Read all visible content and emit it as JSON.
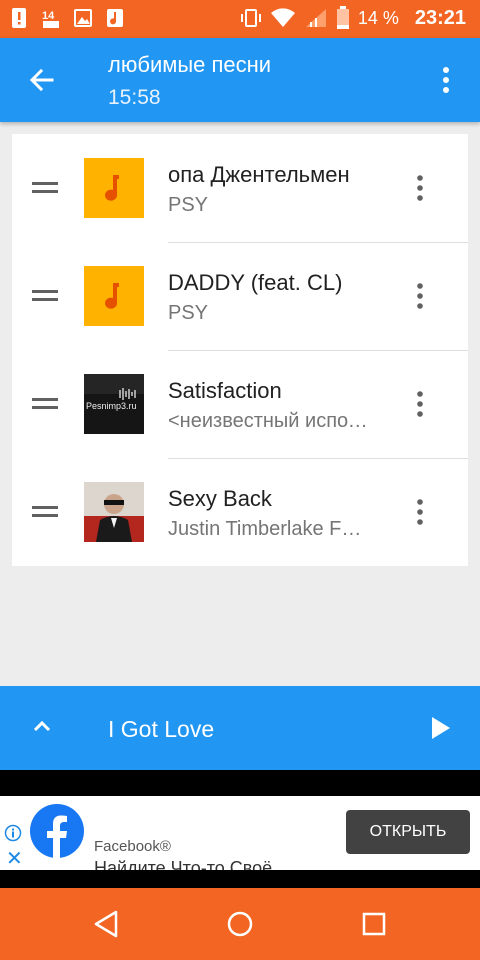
{
  "status_bar": {
    "battery": "14 %",
    "time": "23:21",
    "icons": [
      "alert-icon",
      "notification-icon",
      "image-icon",
      "music-icon",
      "vibrate-icon",
      "wifi-icon",
      "signal-icon",
      "battery-icon"
    ]
  },
  "app_bar": {
    "title": "любимые песни",
    "duration": "15:58",
    "icons": [
      "back-arrow-icon",
      "more-vert-icon"
    ]
  },
  "playlist": {
    "songs": [
      {
        "title": "опа Джентельмен",
        "artist": "PSY",
        "thumbnail": "music-note-icon"
      },
      {
        "title": "DADDY (feat. CL)",
        "artist": "PSY",
        "thumbnail": "music-note-icon"
      },
      {
        "title": "Satisfaction",
        "artist": "<неизвестный исполнитель>",
        "thumbnail": "album-art",
        "thumbnail_text": "Pesnimp3.ru"
      },
      {
        "title": "Sexy Back",
        "artist": "Justin Timberlake Feat. Timbaland",
        "thumbnail": "album-art"
      }
    ]
  },
  "player": {
    "current_song": "I Got Love",
    "icons": [
      "chevron-up-icon",
      "play-icon"
    ]
  },
  "ad": {
    "name": "Facebook®",
    "text": "Найдите Что-то Своё",
    "button_label": "ОТКРЫТЬ",
    "icons": [
      "info-icon",
      "close-icon",
      "facebook-logo"
    ]
  },
  "nav_bar": {
    "icons": [
      "back-triangle-icon",
      "home-circle-icon",
      "recents-square-icon"
    ]
  },
  "colors": {
    "accent": "#2196f3",
    "status_bar": "#f26522",
    "note_thumb": "#ffb300"
  }
}
